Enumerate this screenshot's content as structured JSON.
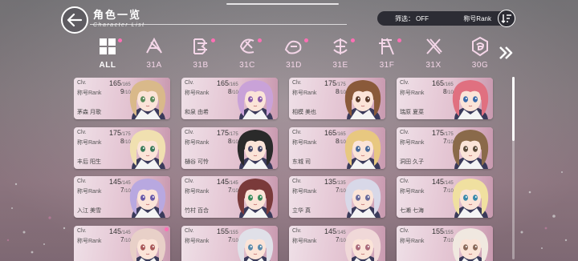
{
  "header": {
    "title_cn": "角色一览",
    "title_en": "Character List",
    "filter_label": "筛选：",
    "filter_value": "OFF",
    "sort_label": "称号Rank"
  },
  "tabs": [
    {
      "label": "ALL",
      "active": true,
      "dot": true,
      "icon": "all-grid-icon"
    },
    {
      "label": "31A",
      "dot": false,
      "icon": "squad-31a-icon"
    },
    {
      "label": "31B",
      "dot": true,
      "icon": "squad-31b-icon"
    },
    {
      "label": "31C",
      "dot": true,
      "icon": "squad-31c-icon"
    },
    {
      "label": "31D",
      "dot": true,
      "icon": "squad-31d-icon"
    },
    {
      "label": "31E",
      "dot": true,
      "icon": "squad-31e-icon"
    },
    {
      "label": "31F",
      "dot": true,
      "icon": "squad-31f-icon"
    },
    {
      "label": "31X",
      "dot": false,
      "icon": "squad-31x-icon"
    },
    {
      "label": "30G",
      "dot": false,
      "icon": "squad-30g-icon"
    }
  ],
  "card_labels": {
    "clv": "Clv.",
    "rank": "称号Rank"
  },
  "characters": [
    {
      "name": "茅森 月歌",
      "lvl": "165",
      "max": "/165",
      "rank": "9",
      "rmax": "/10",
      "hair": "#d9b98a",
      "eye": "#5a8a5a",
      "dot": false
    },
    {
      "name": "和泉 由希",
      "lvl": "165",
      "max": "/165",
      "rank": "8",
      "rmax": "/10",
      "hair": "#c9a2d8",
      "eye": "#8a5aa8",
      "dot": false
    },
    {
      "name": "相模 美也",
      "lvl": "175",
      "max": "/175",
      "rank": "8",
      "rmax": "/10",
      "hair": "#8a5a3a",
      "eye": "#5a3a2a",
      "dot": false
    },
    {
      "name": "瑞原 夏菜",
      "lvl": "165",
      "max": "/165",
      "rank": "8",
      "rmax": "/10",
      "hair": "#e07080",
      "eye": "#3a6aaa",
      "dot": false
    },
    {
      "name": "丰后 阳生",
      "lvl": "175",
      "max": "/175",
      "rank": "8",
      "rmax": "/10",
      "hair": "#f0e0b0",
      "eye": "#3a7a5a",
      "dot": false
    },
    {
      "name": "樋谷 可怜",
      "lvl": "175",
      "max": "/175",
      "rank": "8",
      "rmax": "/10",
      "hair": "#2a2a2a",
      "eye": "#4a4a6a",
      "dot": false
    },
    {
      "name": "东城 司",
      "lvl": "165",
      "max": "/165",
      "rank": "8",
      "rmax": "/10",
      "hair": "#e8c880",
      "eye": "#4a6a9a",
      "dot": false
    },
    {
      "name": "洞田 久子",
      "lvl": "175",
      "max": "/175",
      "rank": "7",
      "rmax": "/10",
      "hair": "#8a6a4a",
      "eye": "#5a4a3a",
      "dot": false
    },
    {
      "name": "入江 美雪",
      "lvl": "145",
      "max": "/145",
      "rank": "7",
      "rmax": "/10",
      "hair": "#b8a8e0",
      "eye": "#6a5aa8",
      "dot": false
    },
    {
      "name": "竹村 百合",
      "lvl": "145",
      "max": "/145",
      "rank": "7",
      "rmax": "/10",
      "hair": "#7a3a3a",
      "eye": "#3a8a5a",
      "dot": false
    },
    {
      "name": "立华 真",
      "lvl": "135",
      "max": "/135",
      "rank": "7",
      "rmax": "/10",
      "hair": "#d8d8e8",
      "eye": "#6a6a9a",
      "dot": false
    },
    {
      "name": "七濑 七海",
      "lvl": "145",
      "max": "/145",
      "rank": "7",
      "rmax": "/10",
      "hair": "#f0e0a0",
      "eye": "#3a8aaa",
      "dot": false
    },
    {
      "name": "",
      "lvl": "145",
      "max": "/145",
      "rank": "7",
      "rmax": "/10",
      "hair": "#e8d0c8",
      "eye": "#aa5a5a",
      "dot": true
    },
    {
      "name": "",
      "lvl": "155",
      "max": "/155",
      "rank": "7",
      "rmax": "/10",
      "hair": "#e0e0e8",
      "eye": "#5a8aaa",
      "dot": false
    },
    {
      "name": "",
      "lvl": "145",
      "max": "/145",
      "rank": "7",
      "rmax": "/10",
      "hair": "#f0d8d8",
      "eye": "#aa6a7a",
      "dot": false
    },
    {
      "name": "",
      "lvl": "155",
      "max": "/155",
      "rank": "7",
      "rmax": "/10",
      "hair": "#f0e8e0",
      "eye": "#8a6a5a",
      "dot": false
    }
  ]
}
